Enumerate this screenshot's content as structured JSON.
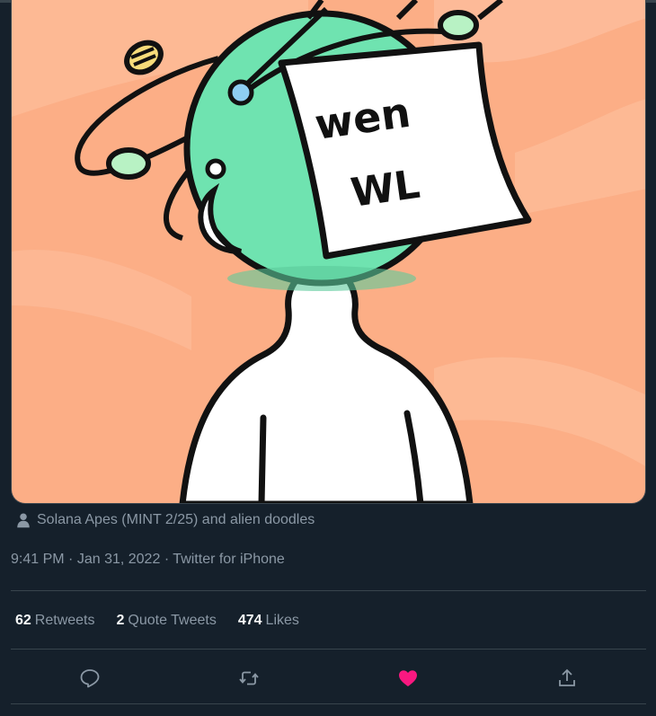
{
  "media": {
    "note_line1": "wen",
    "note_line2": "WL"
  },
  "tagged": {
    "icon": "person-icon",
    "text": "Solana Apes (MINT 2/25) and alien doodles"
  },
  "meta": {
    "time": "9:41 PM",
    "separator": "·",
    "date": "Jan 31, 2022",
    "source": "Twitter for iPhone"
  },
  "stats": {
    "retweets_count": "62",
    "retweets_label": "Retweets",
    "quotes_count": "2",
    "quotes_label": "Quote Tweets",
    "likes_count": "474",
    "likes_label": "Likes"
  },
  "actions": {
    "reply_icon": "reply-icon",
    "retweet_icon": "retweet-icon",
    "like_icon": "heart-icon",
    "share_icon": "share-icon",
    "like_color": "#f91880",
    "icon_color": "#8b98a5"
  },
  "colors": {
    "background": "#15202b",
    "divider": "#38444d",
    "art_background": "#fcae86",
    "helmet": "#6fe3b0"
  }
}
